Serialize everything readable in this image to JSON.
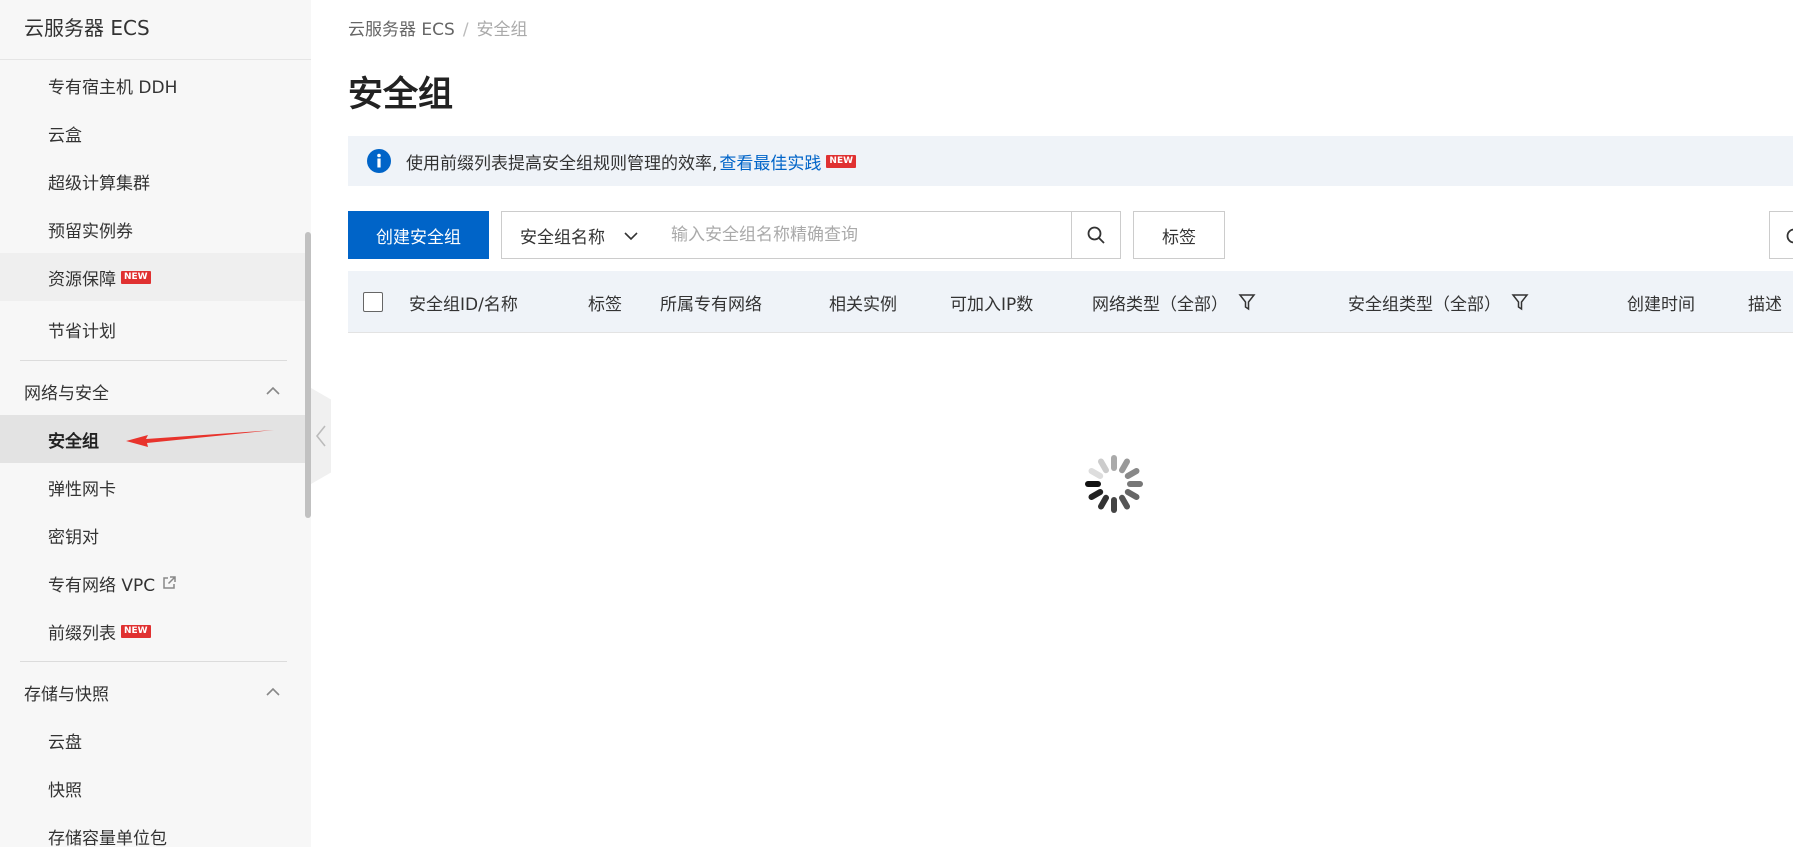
{
  "sidebar": {
    "title": "云服务器 ECS",
    "items_top": [
      {
        "label": "专有宿主机 DDH"
      },
      {
        "label": "云盒"
      },
      {
        "label": "超级计算集群"
      },
      {
        "label": "预留实例券"
      },
      {
        "label": "资源保障",
        "badge": "NEW"
      },
      {
        "label": "节省计划"
      }
    ],
    "group_network": {
      "title": "网络与安全",
      "items": [
        {
          "label": "安全组"
        },
        {
          "label": "弹性网卡"
        },
        {
          "label": "密钥对"
        },
        {
          "label": "专有网络 VPC"
        },
        {
          "label": "前缀列表",
          "badge": "NEW"
        }
      ]
    },
    "group_storage": {
      "title": "存储与快照",
      "items": [
        {
          "label": "云盘"
        },
        {
          "label": "快照"
        },
        {
          "label": "存储容量单位包"
        }
      ]
    }
  },
  "breadcrumb": {
    "root": "云服务器 ECS",
    "separator": "/",
    "current": "安全组"
  },
  "page_title": "安全组",
  "banner": {
    "text": "使用前缀列表提高安全组规则管理的效率,",
    "link": "查看最佳实践",
    "badge": "NEW"
  },
  "toolbar": {
    "create_label": "创建安全组",
    "select_value": "安全组名称",
    "search_placeholder": "输入安全组名称精确查询",
    "tag_label": "标签"
  },
  "table": {
    "headers": {
      "id_name": "安全组ID/名称",
      "tags": "标签",
      "vpc": "所属专有网络",
      "instances": "相关实例",
      "ip_count": "可加入IP数",
      "network_type": "网络类型（全部）",
      "sg_type": "安全组类型（全部）",
      "created": "创建时间",
      "desc": "描述"
    }
  },
  "colors": {
    "primary": "#0064c8",
    "badge_red": "#e03131",
    "banner_bg": "#eff3f8",
    "annotation_arrow": "#e8332c"
  }
}
